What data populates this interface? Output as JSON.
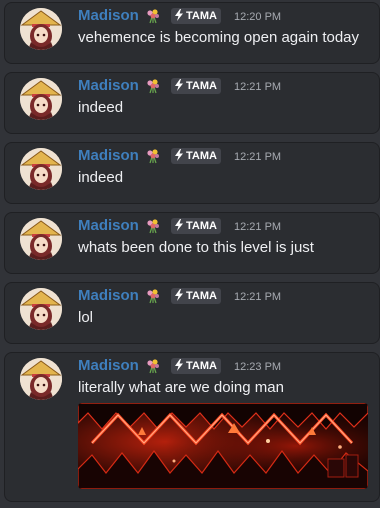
{
  "messages": [
    {
      "author": "Madison",
      "tag": "TAMA",
      "time": "12:20 PM",
      "text": "vehemence is becoming open again today"
    },
    {
      "author": "Madison",
      "tag": "TAMA",
      "time": "12:21 PM",
      "text": "indeed"
    },
    {
      "author": "Madison",
      "tag": "TAMA",
      "time": "12:21 PM",
      "text": "indeed"
    },
    {
      "author": "Madison",
      "tag": "TAMA",
      "time": "12:21 PM",
      "text": "whats been done to this level is just"
    },
    {
      "author": "Madison",
      "tag": "TAMA",
      "time": "12:21 PM",
      "text": "lol"
    },
    {
      "author": "Madison",
      "tag": "TAMA",
      "time": "12:23 PM",
      "text": "literally what are we doing man"
    }
  ],
  "icons": {
    "flower": "bouquet-icon",
    "tag": "lightning-bolt-icon",
    "attachment": "level-screenshot-image"
  },
  "colors": {
    "background": "#313338",
    "card": "#2b2d31",
    "username": "#3f7fbd",
    "text": "#eeeff2",
    "timestamp": "#a7aab1",
    "tag_bg": "#42444b"
  }
}
